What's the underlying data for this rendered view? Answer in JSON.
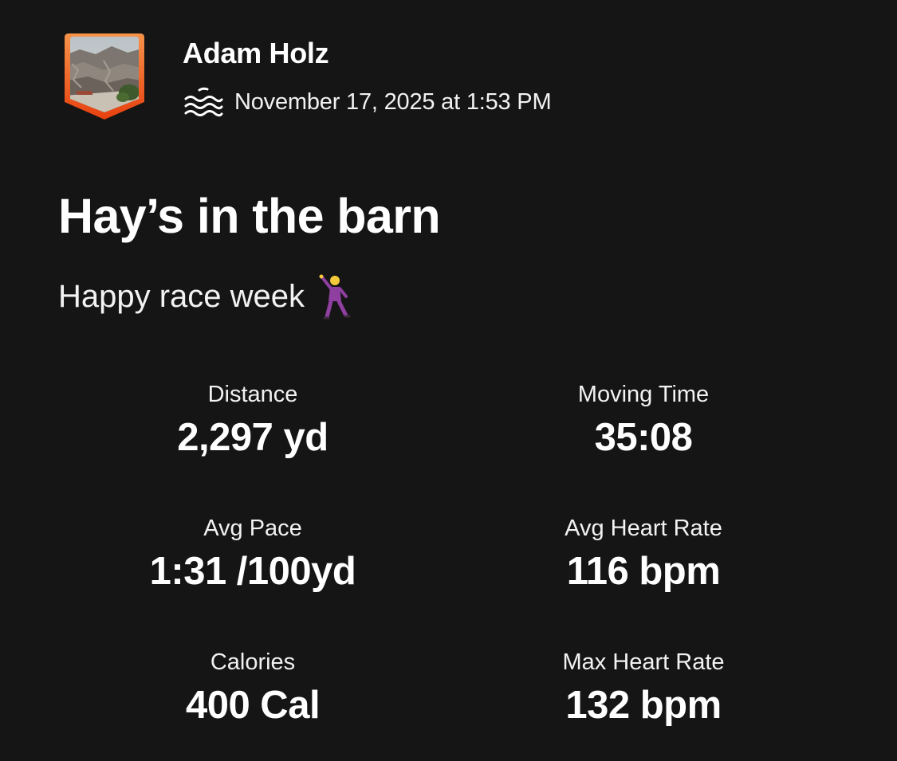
{
  "activity": {
    "athlete_name": "Adam Holz",
    "activity_type_icon": "swim-icon",
    "date": "November 17, 2025 at 1:53 PM",
    "title": "Hay’s in the barn",
    "description": "Happy race week",
    "description_emoji": "dancer-icon"
  },
  "stats": [
    {
      "label": "Distance",
      "value": "2,297 yd"
    },
    {
      "label": "Moving Time",
      "value": "35:08"
    },
    {
      "label": "Avg Pace",
      "value": "1:31 /100yd"
    },
    {
      "label": "Avg Heart Rate",
      "value": "116 bpm"
    },
    {
      "label": "Calories",
      "value": "400 Cal"
    },
    {
      "label": "Max Heart Rate",
      "value": "132 bpm"
    }
  ],
  "colors": {
    "background": "#151515",
    "text": "#ffffff",
    "avatar_border": "#f05a1a",
    "dancer": "#8e3fa0"
  }
}
